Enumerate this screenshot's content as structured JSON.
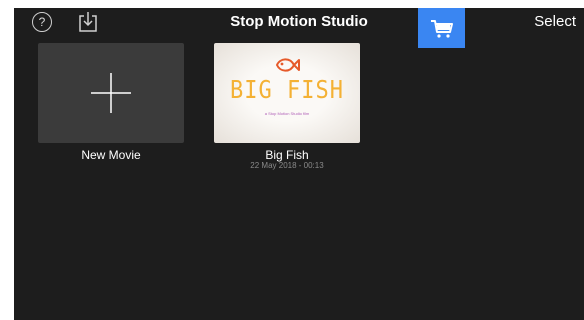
{
  "app": {
    "title": "Stop Motion Studio"
  },
  "toolbar": {
    "help_icon": "question-circle-icon",
    "help_glyph": "?",
    "import_icon": "download-tray-icon",
    "store_icon": "shopping-cart-icon",
    "select_label": "Select"
  },
  "colors": {
    "background": "#1d1d1d",
    "accent": "#3a86f2",
    "title_text": "#f4b134",
    "subtitle_text": "#b060b8",
    "date_text": "#8a8a8a"
  },
  "movies": [
    {
      "label": "New Movie",
      "icon": "plus-icon"
    },
    {
      "label": "Big Fish",
      "date": "22 May 2018 - 00:13",
      "thumbnail": {
        "title": "BIG FISH",
        "subtitle": "a Stop Motion Studio film",
        "logo": "fish-icon"
      }
    }
  ]
}
